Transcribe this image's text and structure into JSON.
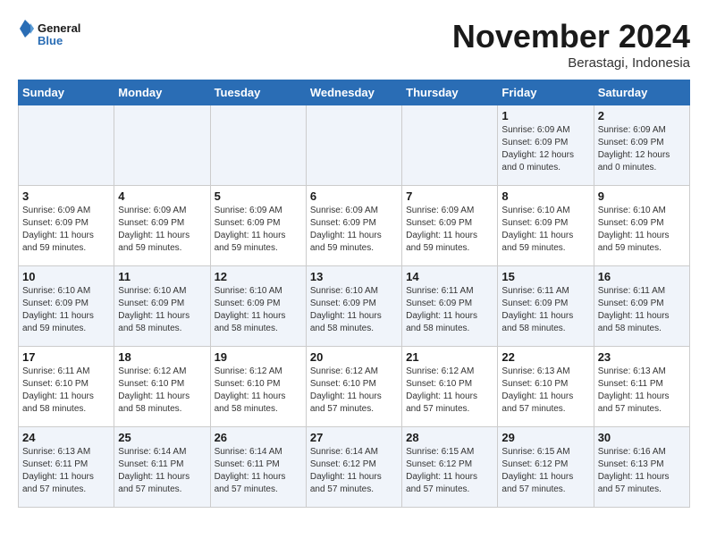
{
  "logo": {
    "line1": "General",
    "line2": "Blue"
  },
  "title": "November 2024",
  "subtitle": "Berastagi, Indonesia",
  "days_header": [
    "Sunday",
    "Monday",
    "Tuesday",
    "Wednesday",
    "Thursday",
    "Friday",
    "Saturday"
  ],
  "weeks": [
    [
      {
        "day": "",
        "info": ""
      },
      {
        "day": "",
        "info": ""
      },
      {
        "day": "",
        "info": ""
      },
      {
        "day": "",
        "info": ""
      },
      {
        "day": "",
        "info": ""
      },
      {
        "day": "1",
        "info": "Sunrise: 6:09 AM\nSunset: 6:09 PM\nDaylight: 12 hours\nand 0 minutes."
      },
      {
        "day": "2",
        "info": "Sunrise: 6:09 AM\nSunset: 6:09 PM\nDaylight: 12 hours\nand 0 minutes."
      }
    ],
    [
      {
        "day": "3",
        "info": "Sunrise: 6:09 AM\nSunset: 6:09 PM\nDaylight: 11 hours\nand 59 minutes."
      },
      {
        "day": "4",
        "info": "Sunrise: 6:09 AM\nSunset: 6:09 PM\nDaylight: 11 hours\nand 59 minutes."
      },
      {
        "day": "5",
        "info": "Sunrise: 6:09 AM\nSunset: 6:09 PM\nDaylight: 11 hours\nand 59 minutes."
      },
      {
        "day": "6",
        "info": "Sunrise: 6:09 AM\nSunset: 6:09 PM\nDaylight: 11 hours\nand 59 minutes."
      },
      {
        "day": "7",
        "info": "Sunrise: 6:09 AM\nSunset: 6:09 PM\nDaylight: 11 hours\nand 59 minutes."
      },
      {
        "day": "8",
        "info": "Sunrise: 6:10 AM\nSunset: 6:09 PM\nDaylight: 11 hours\nand 59 minutes."
      },
      {
        "day": "9",
        "info": "Sunrise: 6:10 AM\nSunset: 6:09 PM\nDaylight: 11 hours\nand 59 minutes."
      }
    ],
    [
      {
        "day": "10",
        "info": "Sunrise: 6:10 AM\nSunset: 6:09 PM\nDaylight: 11 hours\nand 59 minutes."
      },
      {
        "day": "11",
        "info": "Sunrise: 6:10 AM\nSunset: 6:09 PM\nDaylight: 11 hours\nand 58 minutes."
      },
      {
        "day": "12",
        "info": "Sunrise: 6:10 AM\nSunset: 6:09 PM\nDaylight: 11 hours\nand 58 minutes."
      },
      {
        "day": "13",
        "info": "Sunrise: 6:10 AM\nSunset: 6:09 PM\nDaylight: 11 hours\nand 58 minutes."
      },
      {
        "day": "14",
        "info": "Sunrise: 6:11 AM\nSunset: 6:09 PM\nDaylight: 11 hours\nand 58 minutes."
      },
      {
        "day": "15",
        "info": "Sunrise: 6:11 AM\nSunset: 6:09 PM\nDaylight: 11 hours\nand 58 minutes."
      },
      {
        "day": "16",
        "info": "Sunrise: 6:11 AM\nSunset: 6:09 PM\nDaylight: 11 hours\nand 58 minutes."
      }
    ],
    [
      {
        "day": "17",
        "info": "Sunrise: 6:11 AM\nSunset: 6:10 PM\nDaylight: 11 hours\nand 58 minutes."
      },
      {
        "day": "18",
        "info": "Sunrise: 6:12 AM\nSunset: 6:10 PM\nDaylight: 11 hours\nand 58 minutes."
      },
      {
        "day": "19",
        "info": "Sunrise: 6:12 AM\nSunset: 6:10 PM\nDaylight: 11 hours\nand 58 minutes."
      },
      {
        "day": "20",
        "info": "Sunrise: 6:12 AM\nSunset: 6:10 PM\nDaylight: 11 hours\nand 57 minutes."
      },
      {
        "day": "21",
        "info": "Sunrise: 6:12 AM\nSunset: 6:10 PM\nDaylight: 11 hours\nand 57 minutes."
      },
      {
        "day": "22",
        "info": "Sunrise: 6:13 AM\nSunset: 6:10 PM\nDaylight: 11 hours\nand 57 minutes."
      },
      {
        "day": "23",
        "info": "Sunrise: 6:13 AM\nSunset: 6:11 PM\nDaylight: 11 hours\nand 57 minutes."
      }
    ],
    [
      {
        "day": "24",
        "info": "Sunrise: 6:13 AM\nSunset: 6:11 PM\nDaylight: 11 hours\nand 57 minutes."
      },
      {
        "day": "25",
        "info": "Sunrise: 6:14 AM\nSunset: 6:11 PM\nDaylight: 11 hours\nand 57 minutes."
      },
      {
        "day": "26",
        "info": "Sunrise: 6:14 AM\nSunset: 6:11 PM\nDaylight: 11 hours\nand 57 minutes."
      },
      {
        "day": "27",
        "info": "Sunrise: 6:14 AM\nSunset: 6:12 PM\nDaylight: 11 hours\nand 57 minutes."
      },
      {
        "day": "28",
        "info": "Sunrise: 6:15 AM\nSunset: 6:12 PM\nDaylight: 11 hours\nand 57 minutes."
      },
      {
        "day": "29",
        "info": "Sunrise: 6:15 AM\nSunset: 6:12 PM\nDaylight: 11 hours\nand 57 minutes."
      },
      {
        "day": "30",
        "info": "Sunrise: 6:16 AM\nSunset: 6:13 PM\nDaylight: 11 hours\nand 57 minutes."
      }
    ]
  ]
}
